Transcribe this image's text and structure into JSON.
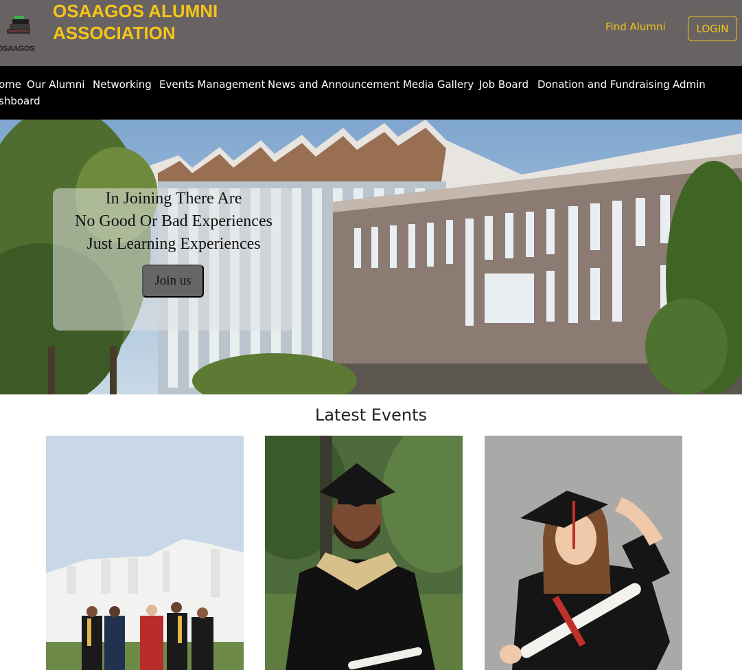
{
  "header": {
    "logo_text": "OSAAGOS",
    "brand_line1": "OSAAGOS ALUMNI",
    "brand_line2": "ASSOCIATION",
    "find_alumni": "Find Alumni",
    "login": "LOGIN"
  },
  "nav": {
    "items": [
      "ome",
      "Our Alumni",
      "Networking",
      "Events Management",
      "News and Announcement",
      "Media Gallery",
      "Job Board",
      "Donation and Fundraising",
      "Admin"
    ],
    "wrap": "shboard"
  },
  "hero": {
    "line1": "In Joining There Are",
    "line2": "No Good Or Bad Experiences",
    "line3": "Just Learning Experiences",
    "cta": "Join us"
  },
  "events": {
    "title": "Latest Events"
  },
  "colors": {
    "header_bg": "#686263",
    "accent": "#f5c518",
    "nav_bg": "#000000"
  }
}
